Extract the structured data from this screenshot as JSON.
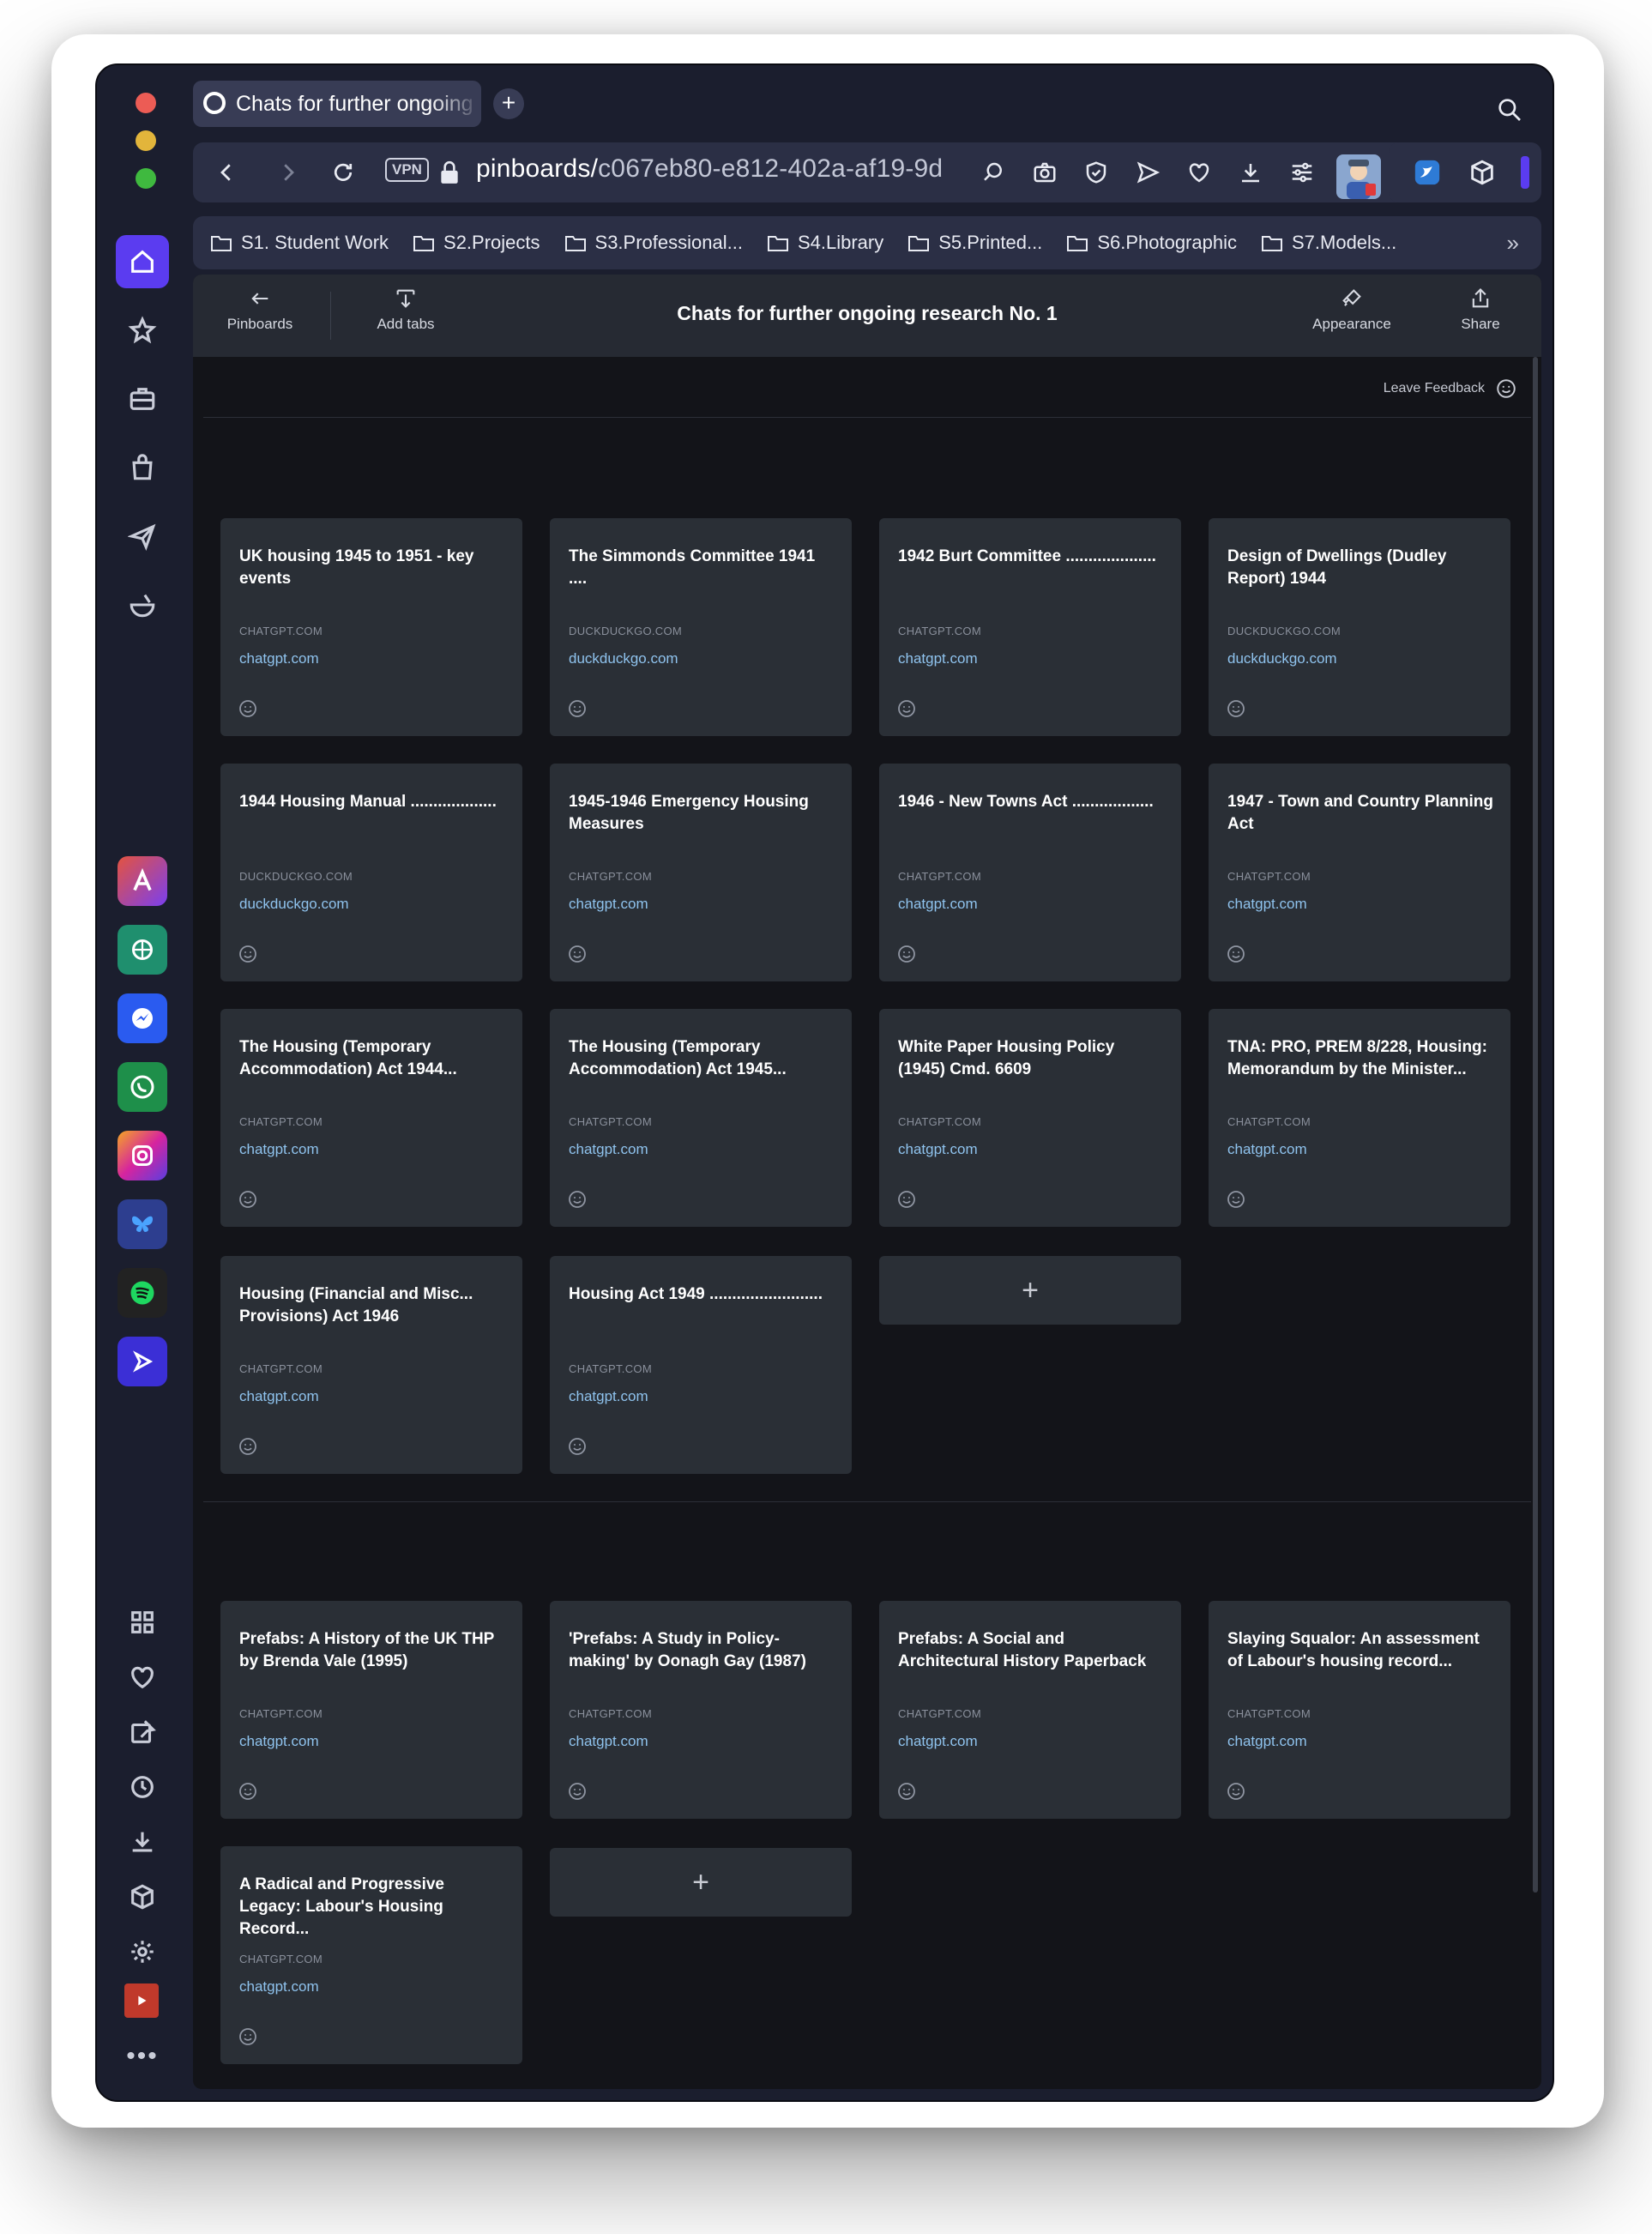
{
  "tab": {
    "title": "Chats for further ongoing"
  },
  "address": {
    "url_main": "pinboards/",
    "url_id": "c067eb80-e812-402a-af19-9d",
    "vpn": "VPN"
  },
  "bookmarks": [
    {
      "label": "S1. Student Work"
    },
    {
      "label": "S2.Projects"
    },
    {
      "label": "S3.Professional..."
    },
    {
      "label": "S4.Library"
    },
    {
      "label": "S5.Printed..."
    },
    {
      "label": "S6.Photographic"
    },
    {
      "label": "S7.Models..."
    }
  ],
  "bookmarks_more": "»",
  "toolbar": {
    "back_label": "Pinboards",
    "add_tabs_label": "Add tabs",
    "title": "Chats for further ongoing research No. 1",
    "appearance_label": "Appearance",
    "share_label": "Share"
  },
  "feedback_label": "Leave Feedback",
  "add_symbol": "+",
  "section1": [
    {
      "title": "UK housing 1945 to 1951 - key events",
      "domain": "CHATGPT.COM",
      "link": "chatgpt.com"
    },
    {
      "title": "The Simmonds Committee 1941 ....",
      "domain": "DUCKDUCKGO.COM",
      "link": "duckduckgo.com"
    },
    {
      "title": "1942 Burt Committee ....................",
      "domain": "CHATGPT.COM",
      "link": "chatgpt.com"
    },
    {
      "title": "Design of Dwellings (Dudley Report) 1944",
      "domain": "DUCKDUCKGO.COM",
      "link": "duckduckgo.com"
    },
    {
      "title": "1944 Housing Manual ...................",
      "domain": "DUCKDUCKGO.COM",
      "link": "duckduckgo.com"
    },
    {
      "title": "1945-1946 Emergency Housing Measures",
      "domain": "CHATGPT.COM",
      "link": "chatgpt.com"
    },
    {
      "title": "1946 - New Towns Act ..................",
      "domain": "CHATGPT.COM",
      "link": "chatgpt.com"
    },
    {
      "title": "1947 - Town and Country Planning Act",
      "domain": "CHATGPT.COM",
      "link": "chatgpt.com"
    },
    {
      "title": "The Housing (Temporary Accommodation) Act 1944...",
      "domain": "CHATGPT.COM",
      "link": "chatgpt.com"
    },
    {
      "title": "The Housing (Temporary Accommodation) Act 1945...",
      "domain": "CHATGPT.COM",
      "link": "chatgpt.com"
    },
    {
      "title": "White Paper Housing Policy (1945) Cmd. 6609",
      "domain": "CHATGPT.COM",
      "link": "chatgpt.com"
    },
    {
      "title": "TNA: PRO, PREM 8/228, Housing: Memorandum by the Minister...",
      "domain": "CHATGPT.COM",
      "link": "chatgpt.com"
    },
    {
      "title": "Housing (Financial and Misc... Provisions) Act 1946",
      "domain": "CHATGPT.COM",
      "link": "chatgpt.com"
    },
    {
      "title": "Housing Act 1949 .........................",
      "domain": "CHATGPT.COM",
      "link": "chatgpt.com"
    }
  ],
  "section2": [
    {
      "title": "Prefabs: A History of the UK THP by Brenda Vale (1995)",
      "domain": "CHATGPT.COM",
      "link": "chatgpt.com"
    },
    {
      "title": "'Prefabs: A Study in Policy-making' by Oonagh Gay (1987)",
      "domain": "CHATGPT.COM",
      "link": "chatgpt.com"
    },
    {
      "title": "Prefabs: A Social and Architectural History Paperback",
      "domain": "CHATGPT.COM",
      "link": "chatgpt.com"
    },
    {
      "title": "Slaying Squalor: An assessment of Labour's housing record...",
      "domain": "CHATGPT.COM",
      "link": "chatgpt.com"
    },
    {
      "title": "A Radical and Progressive Legacy: Labour's Housing Record...",
      "domain": "CHATGPT.COM",
      "link": "chatgpt.com"
    }
  ],
  "colors": {
    "accent": "#5b3cf0",
    "card_bg": "#2a2f36",
    "link": "#8fc3ee"
  }
}
